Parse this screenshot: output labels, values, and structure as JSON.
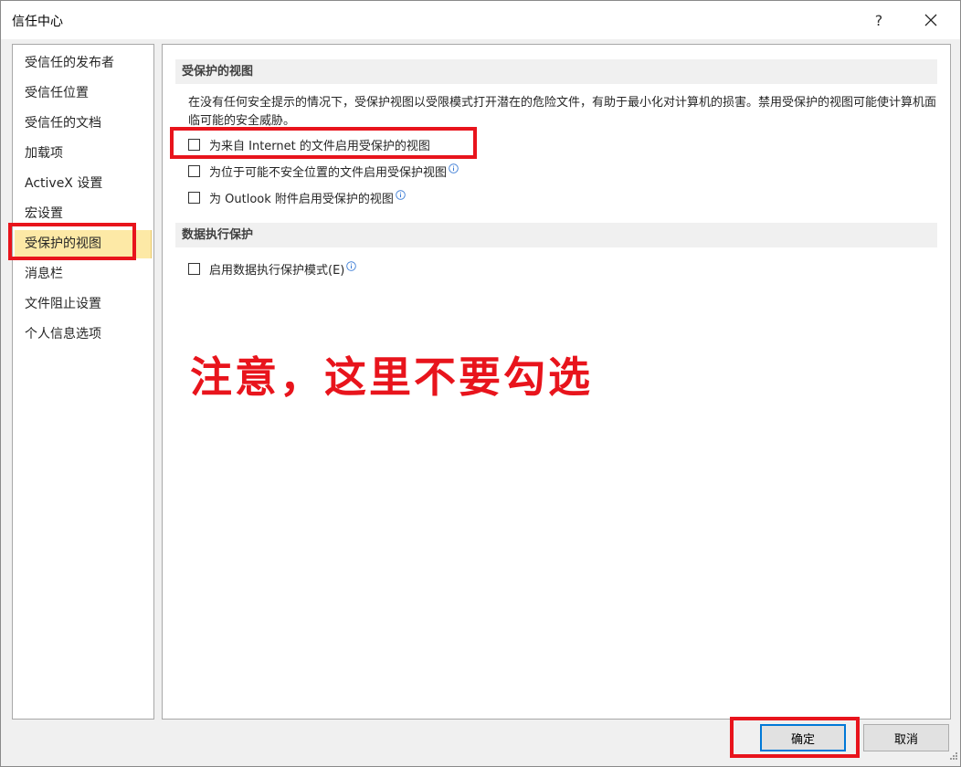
{
  "window": {
    "title": "信任中心",
    "help_label": "?"
  },
  "nav": {
    "items": [
      {
        "label": "受信任的发布者"
      },
      {
        "label": "受信任位置"
      },
      {
        "label": "受信任的文档"
      },
      {
        "label": "加载项"
      },
      {
        "label": "ActiveX 设置"
      },
      {
        "label": "宏设置"
      },
      {
        "label": "受保护的视图",
        "selected": true
      },
      {
        "label": "消息栏"
      },
      {
        "label": "文件阻止设置"
      },
      {
        "label": "个人信息选项"
      }
    ]
  },
  "protected_view": {
    "header": "受保护的视图",
    "description": "在没有任何安全提示的情况下，受保护视图以受限模式打开潜在的危险文件，有助于最小化对计算机的损害。禁用受保护的视图可能使计算机面临可能的安全威胁。",
    "options": [
      {
        "label": "为来自 Internet 的文件启用受保护的视图",
        "checked": false,
        "info": false
      },
      {
        "label": "为位于可能不安全位置的文件启用受保护视图",
        "checked": false,
        "info": true
      },
      {
        "label": "为 Outlook 附件启用受保护的视图",
        "checked": false,
        "info": true
      }
    ]
  },
  "dep": {
    "header": "数据执行保护",
    "option_label": "启用数据执行保护模式(E)",
    "checked": false
  },
  "annotation": {
    "note": "注意，这里不要勾选",
    "color": "#e8141c"
  },
  "footer": {
    "ok_label": "确定",
    "cancel_label": "取消"
  },
  "colors": {
    "selected_nav_bg": "#fde9a6",
    "ok_focus_border": "#0078d7",
    "info_icon": "#3a7bd5"
  }
}
